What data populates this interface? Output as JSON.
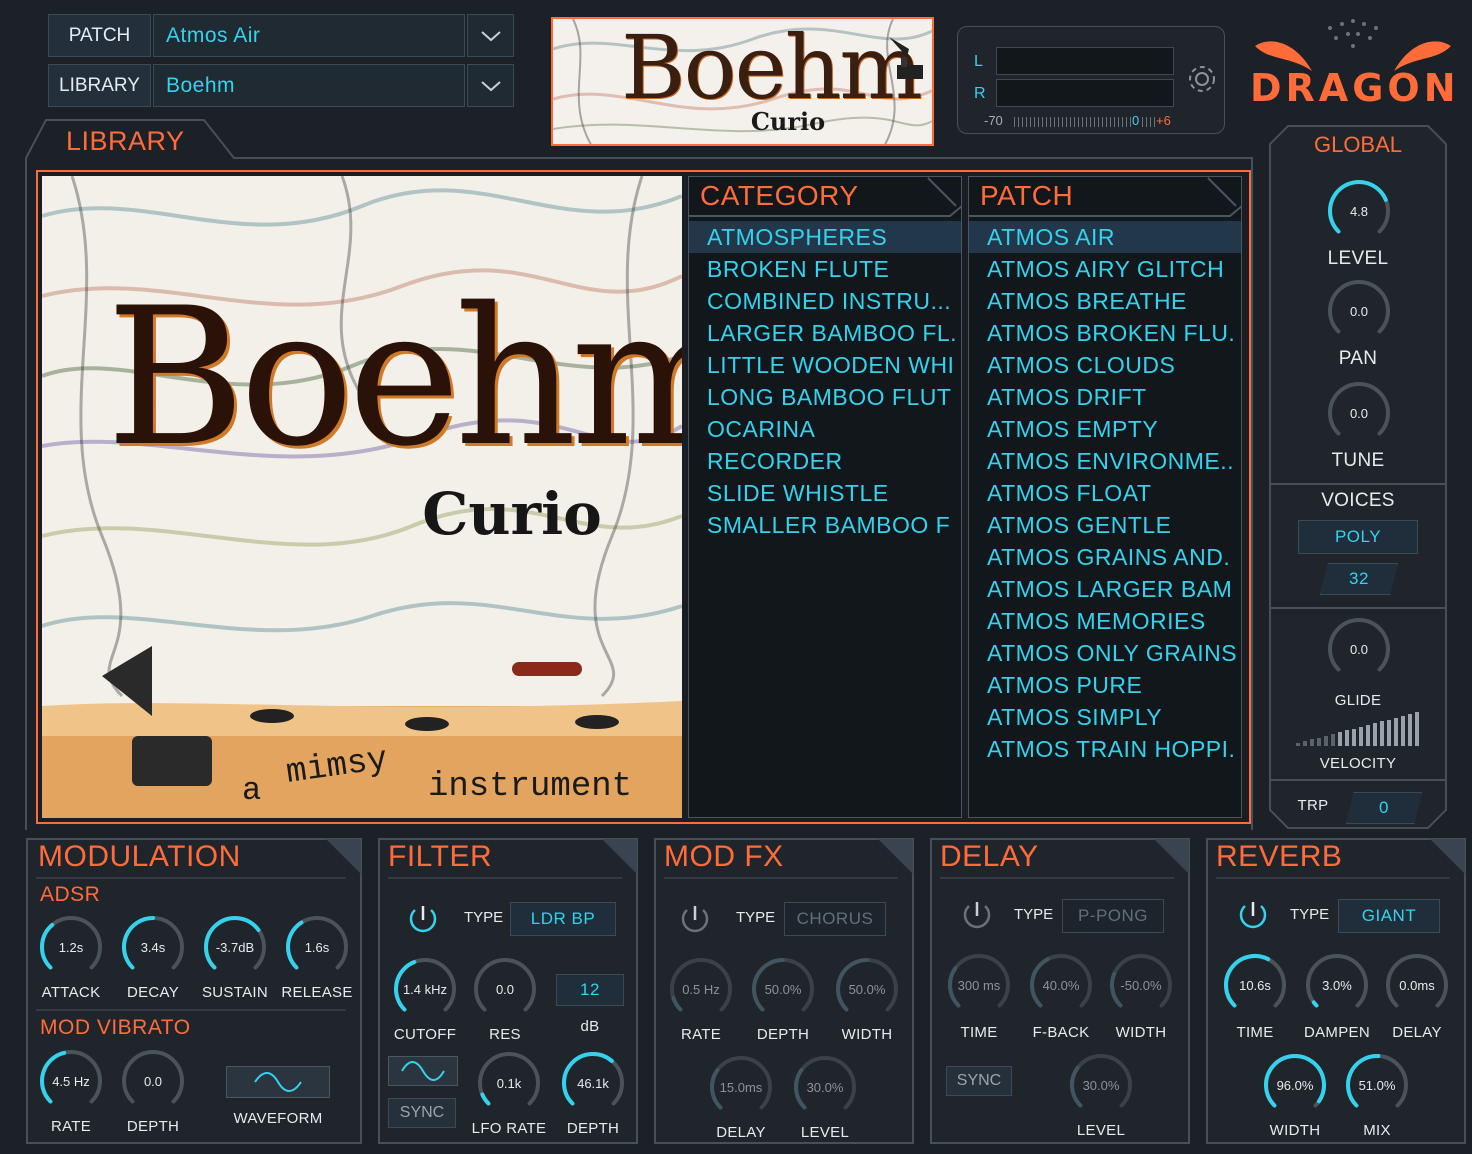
{
  "header": {
    "patch_label": "PATCH",
    "patch_value": "Atmos Air",
    "library_label": "LIBRARY",
    "library_value": "Boehm",
    "logo_text": "Boehm",
    "logo_sub": "Curio"
  },
  "meter": {
    "left_label": "L",
    "right_label": "R",
    "scale_min": "-70",
    "scale_zero": "0",
    "scale_max": "+6"
  },
  "brand": {
    "name": "DRAGON"
  },
  "library": {
    "title": "LIBRARY",
    "art_title": "Boehm",
    "art_subtitle": "Curio",
    "art_tag_a": "a",
    "art_tag_mimsy": "mimsy",
    "art_tag_instrument": "instrument",
    "category_title": "CATEGORY",
    "patch_title": "PATCH",
    "categories": [
      "ATMOSPHERES",
      "BROKEN FLUTE",
      "COMBINED INSTRU...",
      "LARGER BAMBOO FL.",
      "LITTLE WOODEN WHI",
      "LONG BAMBOO FLUT",
      "OCARINA",
      "RECORDER",
      "SLIDE WHISTLE",
      "SMALLER BAMBOO F"
    ],
    "patches": [
      "ATMOS AIR",
      "ATMOS AIRY GLITCH",
      "ATMOS BREATHE",
      "ATMOS BROKEN FLU.",
      "ATMOS CLOUDS",
      "ATMOS DRIFT",
      "ATMOS EMPTY",
      "ATMOS ENVIRONME..",
      "ATMOS FLOAT",
      "ATMOS GENTLE",
      "ATMOS GRAINS AND.",
      "ATMOS LARGER BAM",
      "ATMOS MEMORIES",
      "ATMOS ONLY GRAINS",
      "ATMOS PURE",
      "ATMOS SIMPLY",
      "ATMOS TRAIN HOPPI."
    ]
  },
  "global": {
    "title": "GLOBAL",
    "level_value": "4.8",
    "level_label": "LEVEL",
    "pan_value": "0.0",
    "pan_label": "PAN",
    "tune_value": "0.0",
    "tune_label": "TUNE",
    "voices_label": "VOICES",
    "voices_mode": "POLY",
    "voices_count": "32",
    "glide_value": "0.0",
    "glide_label": "GLIDE",
    "velocity_label": "VELOCITY",
    "trp_label": "TRP",
    "trp_value": "0"
  },
  "modulation": {
    "title": "MODULATION",
    "adsr_title": "ADSR",
    "attack_value": "1.2s",
    "attack_label": "ATTACK",
    "decay_value": "3.4s",
    "decay_label": "DECAY",
    "sustain_value": "-3.7dB",
    "sustain_label": "SUSTAIN",
    "release_value": "1.6s",
    "release_label": "RELEASE",
    "vibrato_title": "MOD VIBRATO",
    "rate_value": "4.5 Hz",
    "rate_label": "RATE",
    "depth_value": "0.0",
    "depth_label": "DEPTH",
    "waveform_label": "WAVEFORM"
  },
  "filter": {
    "title": "FILTER",
    "type_label": "TYPE",
    "type_value": "LDR BP",
    "cutoff_value": "1.4 kHz",
    "cutoff_label": "CUTOFF",
    "res_value": "0.0",
    "res_label": "RES",
    "db_value": "12",
    "db_label": "dB",
    "sync_label": "SYNC",
    "lfo_value": "0.1k",
    "lfo_label": "LFO RATE",
    "depth_value": "46.1k",
    "depth_label": "DEPTH"
  },
  "modfx": {
    "title": "MOD FX",
    "type_label": "TYPE",
    "type_value": "CHORUS",
    "rate_value": "0.5 Hz",
    "rate_label": "RATE",
    "depth_value": "50.0%",
    "depth_label": "DEPTH",
    "width_value": "50.0%",
    "width_label": "WIDTH",
    "delay_value": "15.0ms",
    "delay_label": "DELAY",
    "level_value": "30.0%",
    "level_label": "LEVEL"
  },
  "delay": {
    "title": "DELAY",
    "type_label": "TYPE",
    "type_value": "P-PONG",
    "time_value": "300 ms",
    "time_label": "TIME",
    "fback_value": "40.0%",
    "fback_label": "F-BACK",
    "width_value": "-50.0%",
    "width_label": "WIDTH",
    "sync_label": "SYNC",
    "level_value": "30.0%",
    "level_label": "LEVEL"
  },
  "reverb": {
    "title": "REVERB",
    "type_label": "TYPE",
    "type_value": "GIANT",
    "time_value": "10.6s",
    "time_label": "TIME",
    "dampen_value": "3.0%",
    "dampen_label": "DAMPEN",
    "delay_value": "0.0ms",
    "delay_label": "DELAY",
    "width_value": "96.0%",
    "width_label": "WIDTH",
    "mix_value": "51.0%",
    "mix_label": "MIX"
  },
  "colors": {
    "accent": "#ff6c3a",
    "value": "#35d2ee",
    "background": "#1c2027"
  }
}
